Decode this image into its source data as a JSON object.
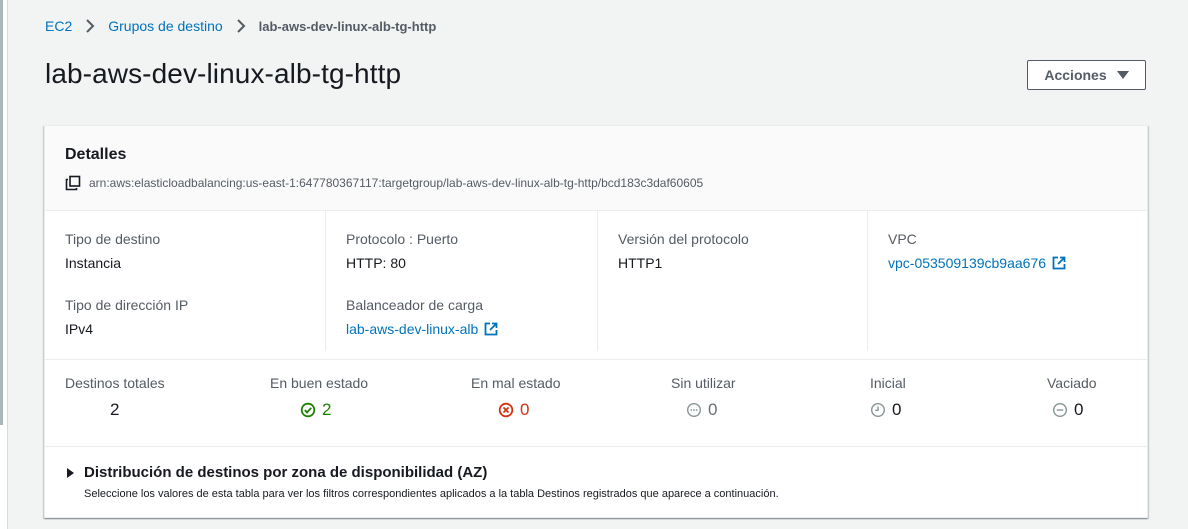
{
  "breadcrumb": {
    "items": [
      "EC2",
      "Grupos de destino"
    ],
    "current": "lab-aws-dev-linux-alb-tg-http"
  },
  "page": {
    "title": "lab-aws-dev-linux-alb-tg-http",
    "actions_label": "Acciones"
  },
  "details": {
    "title": "Detalles",
    "arn": "arn:aws:elasticloadbalancing:us-east-1:647780367117:targetgroup/lab-aws-dev-linux-alb-tg-http/bcd183c3daf60605",
    "fields": {
      "target_type": {
        "label": "Tipo de destino",
        "value": "Instancia"
      },
      "protocol_port": {
        "label": "Protocolo : Puerto",
        "value": "HTTP: 80"
      },
      "protocol_version": {
        "label": "Versión del protocolo",
        "value": "HTTP1"
      },
      "vpc": {
        "label": "VPC",
        "value": "vpc-053509139cb9aa676"
      },
      "ip_type": {
        "label": "Tipo de dirección IP",
        "value": "IPv4"
      },
      "load_balancer": {
        "label": "Balanceador de carga",
        "value": "lab-aws-dev-linux-alb"
      }
    }
  },
  "stats": {
    "total": {
      "label": "Destinos totales",
      "value": "2"
    },
    "healthy": {
      "label": "En buen estado",
      "value": "2",
      "color": "#1d8102"
    },
    "unhealthy": {
      "label": "En mal estado",
      "value": "0",
      "color": "#d13212"
    },
    "unused": {
      "label": "Sin utilizar",
      "value": "0",
      "color": "#687078"
    },
    "initial": {
      "label": "Inicial",
      "value": "0",
      "color": "#687078"
    },
    "draining": {
      "label": "Vaciado",
      "value": "0",
      "color": "#687078"
    }
  },
  "az_section": {
    "title": "Distribución de destinos por zona de disponibilidad (AZ)",
    "description": "Seleccione los valores de esta tabla para ver los filtros correspondientes aplicados a la tabla Destinos registrados que aparece a continuación."
  },
  "colors": {
    "link": "#0073bb",
    "text": "#16191f",
    "muted": "#545b64",
    "background": "#f2f3f3"
  }
}
